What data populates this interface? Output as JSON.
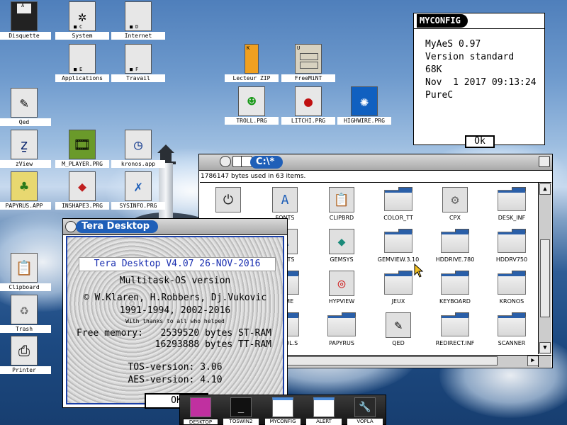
{
  "desktop": {
    "icons": [
      {
        "label": "Disquette",
        "drive": "A",
        "icon": "floppy-icon"
      },
      {
        "label": "System",
        "drive": "C",
        "icon": "drive-icon"
      },
      {
        "label": "Internet",
        "drive": "D",
        "icon": "drive-icon"
      },
      {
        "label": "Applications",
        "drive": "E",
        "icon": "drive-icon"
      },
      {
        "label": "Travail",
        "drive": "F",
        "icon": "drive-icon"
      },
      {
        "label": "Lecteur ZIP",
        "drive": "K",
        "icon": "usb-drive-icon"
      },
      {
        "label": "FreeMiNT",
        "drive": "U",
        "icon": "cabinet-icon"
      },
      {
        "label": "Qed",
        "icon": "pencil-note-icon"
      },
      {
        "label": "TROLL.PRG",
        "icon": "troll-icon"
      },
      {
        "label": "LITCHI.PRG",
        "icon": "litchi-icon"
      },
      {
        "label": "HIGHWIRE.PRG",
        "icon": "highwire-icon"
      },
      {
        "label": "zView",
        "icon": "zview-icon"
      },
      {
        "label": "M_PLAYER.PRG",
        "icon": "film-icon"
      },
      {
        "label": "kronos.app",
        "icon": "clock-icon"
      },
      {
        "label": "PAPYRUS.APP",
        "icon": "papyrus-icon"
      },
      {
        "label": "INSHAPE3.PRG",
        "icon": "shapes-icon"
      },
      {
        "label": "SYSINFO.PRG",
        "icon": "tools-icon"
      },
      {
        "label": "Clipboard",
        "icon": "clipboard-icon"
      },
      {
        "label": "Trash",
        "icon": "recycle-icon"
      },
      {
        "label": "Printer",
        "icon": "printer-icon"
      }
    ]
  },
  "myconfig": {
    "title": "MYCONFIG",
    "lines": [
      "MyAeS 0.97",
      "Version standard",
      "68K",
      "Nov  1 2017 09:13:24",
      "PureC"
    ],
    "ok_label": "Ok"
  },
  "filewin": {
    "path": "C:\\*",
    "info": "1786147 bytes used in 63 items.",
    "items": [
      {
        "label": "",
        "kind": "app",
        "icon": "power-icon"
      },
      {
        "label": "FONTS",
        "kind": "app",
        "icon": "font-icon"
      },
      {
        "label": "CLIPBRD",
        "kind": "app",
        "icon": "clipboard-icon"
      },
      {
        "label": "COLOR_TT",
        "kind": "folder"
      },
      {
        "label": "CPX",
        "kind": "app",
        "icon": "gear-icon"
      },
      {
        "label": "DESK_INF",
        "kind": "folder"
      },
      {
        "label": "",
        "kind": "folder"
      },
      {
        "label": "FONTS",
        "kind": "app",
        "icon": "font-icon"
      },
      {
        "label": "GEMSYS",
        "kind": "app",
        "icon": "diamond-icon"
      },
      {
        "label": "GEMVIEW.3.10",
        "kind": "folder"
      },
      {
        "label": "HDDRIVE.780",
        "kind": "folder"
      },
      {
        "label": "HDDRV750",
        "kind": "folder"
      },
      {
        "label": "",
        "kind": "folder"
      },
      {
        "label": "HOME",
        "kind": "folder"
      },
      {
        "label": "HYPVIEW",
        "kind": "app",
        "icon": "lifebuoy-icon"
      },
      {
        "label": "JEUX",
        "kind": "folder"
      },
      {
        "label": "KEYBOARD",
        "kind": "folder"
      },
      {
        "label": "KRONOS",
        "kind": "folder"
      },
      {
        "label": "",
        "kind": "folder"
      },
      {
        "label": "MTOOL.S",
        "kind": "folder"
      },
      {
        "label": "PAPYRUS",
        "kind": "folder"
      },
      {
        "label": "QED",
        "kind": "app",
        "icon": "pencil-note-icon"
      },
      {
        "label": "REDIRECT.INF",
        "kind": "folder"
      },
      {
        "label": "SCANNER",
        "kind": "folder"
      }
    ]
  },
  "tera": {
    "title": "Tera Desktop",
    "headline": "Tera Desktop V4.07 26-NOV-2016",
    "line1": "Multitask-OS version",
    "line2": "© W.Klaren, H.Robbers, Dj.Vukovic",
    "line3": "1991-1994, 2002-2016",
    "thanks": "With thanks to all who helped",
    "mem_label": "Free memory:",
    "mem_st": "2539520 bytes ST-RAM",
    "mem_tt": "16293888 bytes TT-RAM",
    "tos": "TOS-version: 3.06",
    "aes": "AES-version: 4.10",
    "ok_label": "OK"
  },
  "taskbar": {
    "items": [
      {
        "label": "DESKTOP",
        "icon": "desktop-icon"
      },
      {
        "label": "TOSWIN2",
        "icon": "terminal-icon"
      },
      {
        "label": "MYCONFIG",
        "icon": "window-icon"
      },
      {
        "label": "ALERT",
        "icon": "window-icon"
      },
      {
        "label": "VOPLA",
        "icon": "wrench-icon"
      }
    ]
  },
  "colors": {
    "title_blue": "#1f5fb8",
    "headline_blue": "#1a2fb0"
  }
}
